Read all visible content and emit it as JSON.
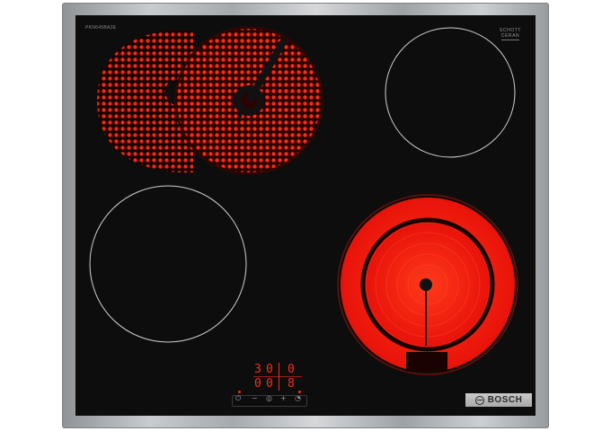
{
  "brand": {
    "label": "BOSCH",
    "logo_icon": "bosch-armature-icon"
  },
  "glass_maker": {
    "line1": "SCHOTT",
    "line2": "CERAN"
  },
  "model_code": "PKN645BA2E",
  "display": {
    "top_left": "3",
    "top_mid": "0",
    "top_right": "0",
    "bottom_left": "0",
    "bottom_mid": "0",
    "bottom_right": "8"
  },
  "controls": {
    "symbols": [
      "power-icon",
      "minus-icon",
      "dual-zone-icon",
      "plus-icon",
      "timer-icon"
    ],
    "glyphs": [
      "⏻",
      "−",
      "◎",
      "+",
      "◔"
    ]
  },
  "colors": {
    "frame": "#b3b6b8",
    "glass": "#0d0d0d",
    "heat": "#ff1a0a",
    "display": "#ff2a1a"
  },
  "zones": [
    {
      "name": "zone-front-left",
      "state": "off"
    },
    {
      "name": "zone-rear-left",
      "state": "on",
      "type": "dual (oval extension)"
    },
    {
      "name": "zone-rear-right",
      "state": "off"
    },
    {
      "name": "zone-front-right",
      "state": "on",
      "type": "dual (ring extension)"
    }
  ]
}
